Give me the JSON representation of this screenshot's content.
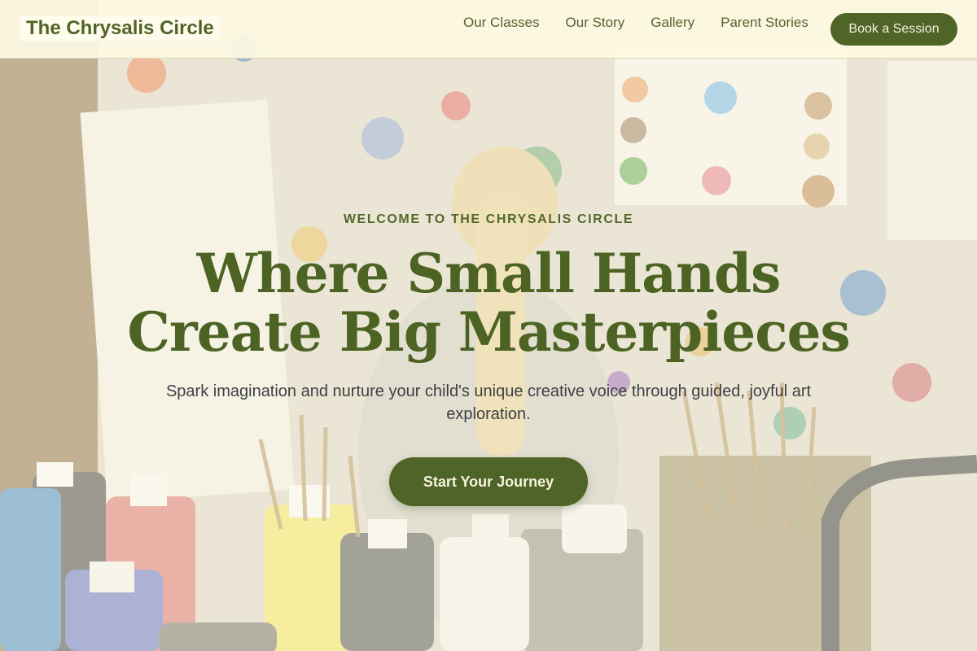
{
  "header": {
    "logo": "The Chrysalis Circle",
    "nav": [
      "Our Classes",
      "Our Story",
      "Gallery",
      "Parent Stories"
    ],
    "cta_label": "Book a Session"
  },
  "hero": {
    "eyebrow": "WELCOME TO THE CHRYSALIS CIRCLE",
    "headline_line1": "Where Small Hands",
    "headline_line2": "Create Big Masterpieces",
    "subtitle": "Spark imagination and nurture your child's unique creative voice through guided, joyful art exploration.",
    "cta_label": "Start Your Journey",
    "background_image": "child painting in a paint-splattered art studio with paint bottles and brushes"
  },
  "colors": {
    "accent": "#4f6427",
    "header_bg": "#fdf8e2",
    "text_dark": "#3d4144"
  }
}
